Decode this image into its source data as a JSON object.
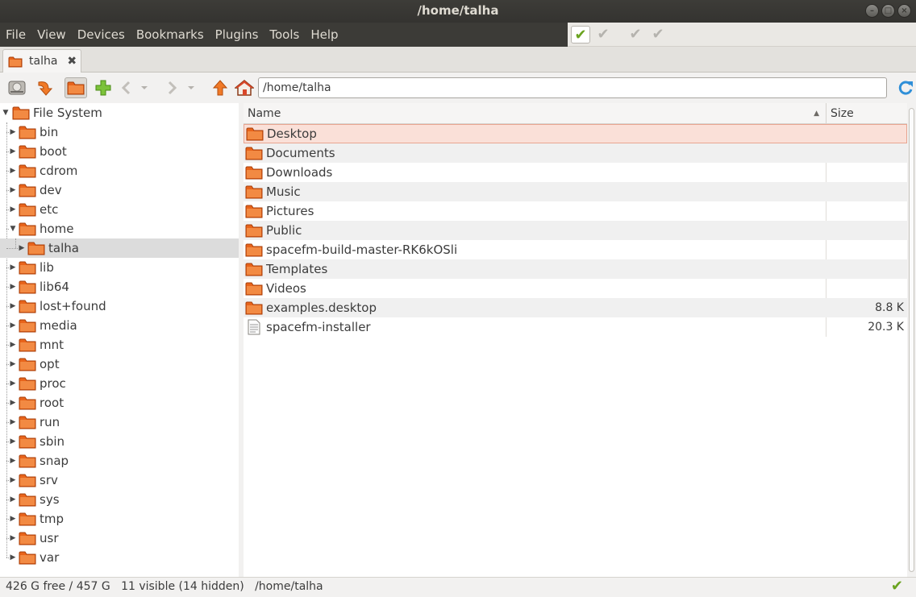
{
  "window": {
    "title": "/home/talha",
    "minimize": "–",
    "maximize": "□",
    "close": "×"
  },
  "menubar": {
    "items": [
      "File",
      "View",
      "Devices",
      "Bookmarks",
      "Plugins",
      "Tools",
      "Help"
    ]
  },
  "task_buttons": [
    "✔",
    "✔",
    "✔",
    "✔"
  ],
  "tab": {
    "label": "talha",
    "close_glyph": "✖"
  },
  "toolbar": {
    "path_value": "/home/talha",
    "icons": [
      "devices-icon",
      "go-down-icon",
      "folder-icon",
      "new-tab-icon",
      "back-icon",
      "back-dropdown-icon",
      "forward-icon",
      "forward-dropdown-icon",
      "up-icon",
      "home-icon",
      "refresh-icon"
    ]
  },
  "sidebar": {
    "root": "File System",
    "items": [
      {
        "label": "bin"
      },
      {
        "label": "boot"
      },
      {
        "label": "cdrom"
      },
      {
        "label": "dev"
      },
      {
        "label": "etc"
      },
      {
        "label": "home",
        "expanded": true
      },
      {
        "label": "talha",
        "child": true,
        "selected": true
      },
      {
        "label": "lib"
      },
      {
        "label": "lib64"
      },
      {
        "label": "lost+found"
      },
      {
        "label": "media"
      },
      {
        "label": "mnt"
      },
      {
        "label": "opt"
      },
      {
        "label": "proc"
      },
      {
        "label": "root"
      },
      {
        "label": "run"
      },
      {
        "label": "sbin"
      },
      {
        "label": "snap"
      },
      {
        "label": "srv"
      },
      {
        "label": "sys"
      },
      {
        "label": "tmp"
      },
      {
        "label": "usr"
      },
      {
        "label": "var"
      }
    ]
  },
  "filelist": {
    "columns": {
      "name": "Name",
      "size": "Size",
      "sort_glyph": "▲"
    },
    "rows": [
      {
        "name": "Desktop",
        "size": "",
        "type": "folder",
        "selected": true
      },
      {
        "name": "Documents",
        "size": "",
        "type": "folder"
      },
      {
        "name": "Downloads",
        "size": "",
        "type": "folder"
      },
      {
        "name": "Music",
        "size": "",
        "type": "folder"
      },
      {
        "name": "Pictures",
        "size": "",
        "type": "folder"
      },
      {
        "name": "Public",
        "size": "",
        "type": "folder"
      },
      {
        "name": "spacefm-build-master-RK6kOSli",
        "size": "",
        "type": "folder"
      },
      {
        "name": "Templates",
        "size": "",
        "type": "folder"
      },
      {
        "name": "Videos",
        "size": "",
        "type": "folder"
      },
      {
        "name": "examples.desktop",
        "size": "8.8 K",
        "type": "folder"
      },
      {
        "name": "spacefm-installer",
        "size": "20.3 K",
        "type": "file"
      }
    ]
  },
  "status": {
    "text": "426 G free / 457 G   11 visible (14 hidden)   /home/talha",
    "check_glyph": "✔"
  },
  "colors": {
    "folder_orange": "#e8641b",
    "accent_green": "#6aa31f",
    "selection": "#fae0d8"
  }
}
